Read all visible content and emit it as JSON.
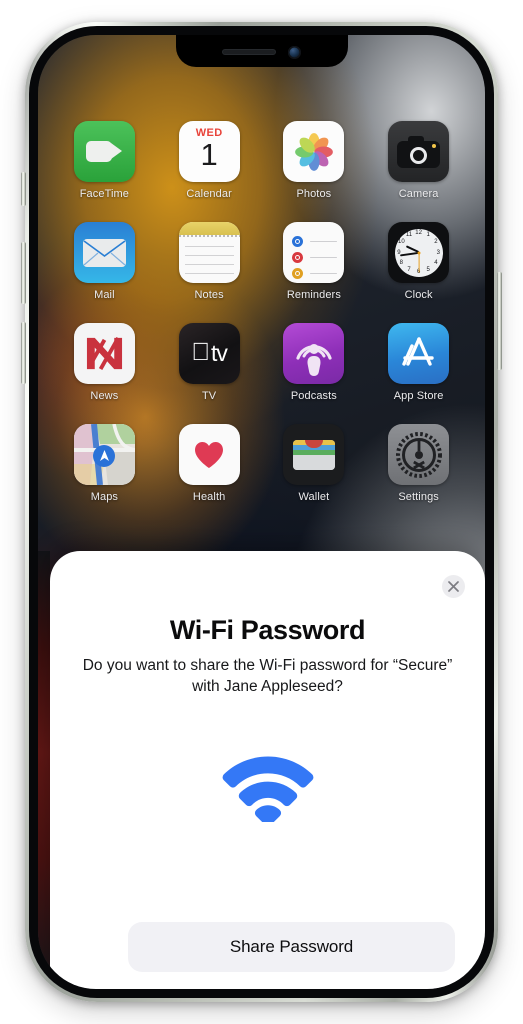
{
  "device": {
    "frame": "iphone",
    "notch": {
      "speaker": "speaker-grille",
      "camera": "front-camera"
    },
    "buttons": [
      "mute-switch",
      "volume-up",
      "volume-down",
      "power-button"
    ]
  },
  "home_screen": {
    "apps": [
      {
        "name": "FaceTime",
        "label": "FaceTime",
        "icon": "facetime-icon",
        "color": "#3cb44a"
      },
      {
        "name": "Calendar",
        "label": "Calendar",
        "icon": "calendar-icon",
        "color": "#ffffff",
        "dow": "WED",
        "day": "1"
      },
      {
        "name": "Photos",
        "label": "Photos",
        "icon": "photos-icon",
        "color": "#fcfcfc"
      },
      {
        "name": "Camera",
        "label": "Camera",
        "icon": "camera-icon",
        "color": "#2d2e30"
      },
      {
        "name": "Mail",
        "label": "Mail",
        "icon": "mail-icon",
        "color": "#2f8fd8"
      },
      {
        "name": "Notes",
        "label": "Notes",
        "icon": "notes-icon",
        "color": "#e8d369"
      },
      {
        "name": "Reminders",
        "label": "Reminders",
        "icon": "reminders-icon",
        "color": "#fafafa"
      },
      {
        "name": "Clock",
        "label": "Clock",
        "icon": "clock-icon",
        "color": "#0e0f11"
      },
      {
        "name": "News",
        "label": "News",
        "icon": "news-icon",
        "color": "#d8333f"
      },
      {
        "name": "TV",
        "label": "TV",
        "icon": "tv-icon",
        "color": "#141315"
      },
      {
        "name": "Podcasts",
        "label": "Podcasts",
        "icon": "podcasts-icon",
        "color": "#9b33c0"
      },
      {
        "name": "App Store",
        "label": "App Store",
        "icon": "app-store-icon",
        "color": "#2f86d6"
      },
      {
        "name": "Maps",
        "label": "Maps",
        "icon": "maps-icon",
        "color": "#e6e3dd"
      },
      {
        "name": "Health",
        "label": "Health",
        "icon": "health-icon",
        "color": "#e03a54"
      },
      {
        "name": "Wallet",
        "label": "Wallet",
        "icon": "wallet-icon",
        "color": "#1b1c1e"
      },
      {
        "name": "Settings",
        "label": "Settings",
        "icon": "settings-icon",
        "color": "#808286"
      }
    ],
    "clock_icon_time": {
      "hour": 10,
      "minute": 8,
      "second": 30
    }
  },
  "sheet": {
    "title": "Wi-Fi Password",
    "message": "Do you want to share the Wi-Fi password for “Secure” with Jane Appleseed?",
    "network_name": "Secure",
    "contact_name": "Jane Appleseed",
    "close_label": "×",
    "icon": "wifi-icon",
    "icon_color": "#3478f6",
    "share_button": {
      "label": "Share Password",
      "background": "#f1f1f5",
      "text_color": "#0d0d0f"
    }
  }
}
